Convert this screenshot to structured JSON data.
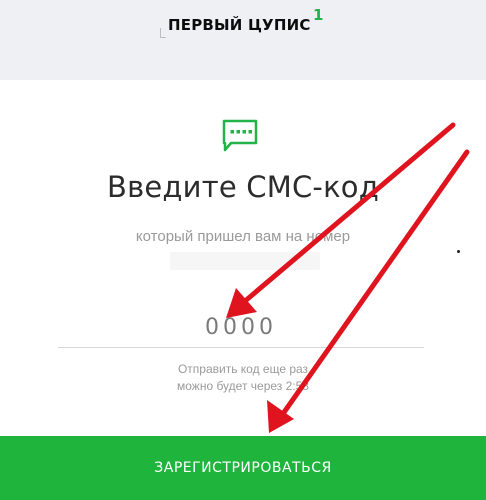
{
  "brand": {
    "name": "ПЕРВЫЙ ЦУПИС",
    "sup": "1"
  },
  "verify": {
    "icon": "sms-chat-icon",
    "title": "Введите СМС-код",
    "subtitle": "который пришел вам на номер",
    "code_placeholder": "0000",
    "resend_line1": "Отправить код еще раз",
    "resend_line2": "можно будет через 2:58"
  },
  "actions": {
    "register_label": "ЗАРЕГИСТРИРОВАТЬСЯ"
  },
  "colors": {
    "accent": "#1fb53d",
    "arrow": "#e0141e",
    "header_bg": "#eff0f3"
  }
}
